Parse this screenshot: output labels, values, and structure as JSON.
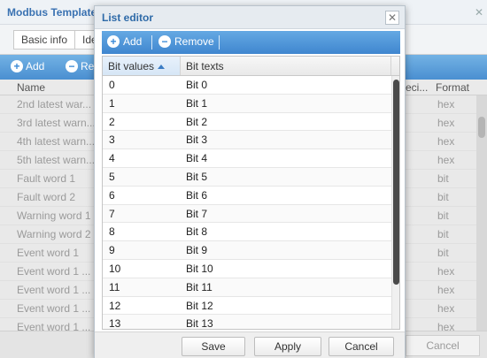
{
  "background": {
    "title": "Modbus Template",
    "tabs": [
      "Basic info",
      "Ide"
    ],
    "toolbar": {
      "add_label": "Add",
      "remove_label": "Re"
    },
    "columns": {
      "name": "Name",
      "deci": "eci...",
      "format": "Format"
    },
    "rows": [
      {
        "name": "2nd latest war...",
        "format": "hex"
      },
      {
        "name": "3rd latest warn...",
        "format": "hex"
      },
      {
        "name": "4th latest warn...",
        "format": "hex"
      },
      {
        "name": "5th latest warn...",
        "format": "hex"
      },
      {
        "name": "Fault word 1",
        "format": "bit"
      },
      {
        "name": "Fault word 2",
        "format": "bit"
      },
      {
        "name": "Warning word 1",
        "format": "bit"
      },
      {
        "name": "Warning word 2",
        "format": "bit"
      },
      {
        "name": "Event word 1",
        "format": "bit"
      },
      {
        "name": "Event word 1 ...",
        "format": "hex"
      },
      {
        "name": "Event word 1 ...",
        "format": "hex"
      },
      {
        "name": "Event word 1 ...",
        "format": "hex"
      },
      {
        "name": "Event word 1 ...",
        "format": "hex"
      }
    ],
    "cancel_label": "Cancel",
    "close_glyph": "✕"
  },
  "dialog": {
    "title": "List editor",
    "close_glyph": "✕",
    "toolbar": {
      "add_label": "Add",
      "remove_label": "Remove"
    },
    "columns": {
      "bit_values": "Bit values",
      "bit_texts": "Bit texts"
    },
    "rows": [
      {
        "value": "0",
        "text": "Bit 0"
      },
      {
        "value": "1",
        "text": "Bit 1"
      },
      {
        "value": "2",
        "text": "Bit 2"
      },
      {
        "value": "3",
        "text": "Bit 3"
      },
      {
        "value": "4",
        "text": "Bit 4"
      },
      {
        "value": "5",
        "text": "Bit 5"
      },
      {
        "value": "6",
        "text": "Bit 6"
      },
      {
        "value": "7",
        "text": "Bit 7"
      },
      {
        "value": "8",
        "text": "Bit 8"
      },
      {
        "value": "9",
        "text": "Bit 9"
      },
      {
        "value": "10",
        "text": "Bit 10"
      },
      {
        "value": "11",
        "text": "Bit 11"
      },
      {
        "value": "12",
        "text": "Bit 12"
      },
      {
        "value": "13",
        "text": "Bit 13"
      }
    ],
    "buttons": {
      "save": "Save",
      "apply": "Apply",
      "cancel": "Cancel"
    }
  },
  "colors": {
    "accent": "#3f86cf",
    "title_text": "#2e6aa8"
  },
  "icons": {
    "add": "plus-circle-icon",
    "remove": "minus-circle-icon"
  }
}
